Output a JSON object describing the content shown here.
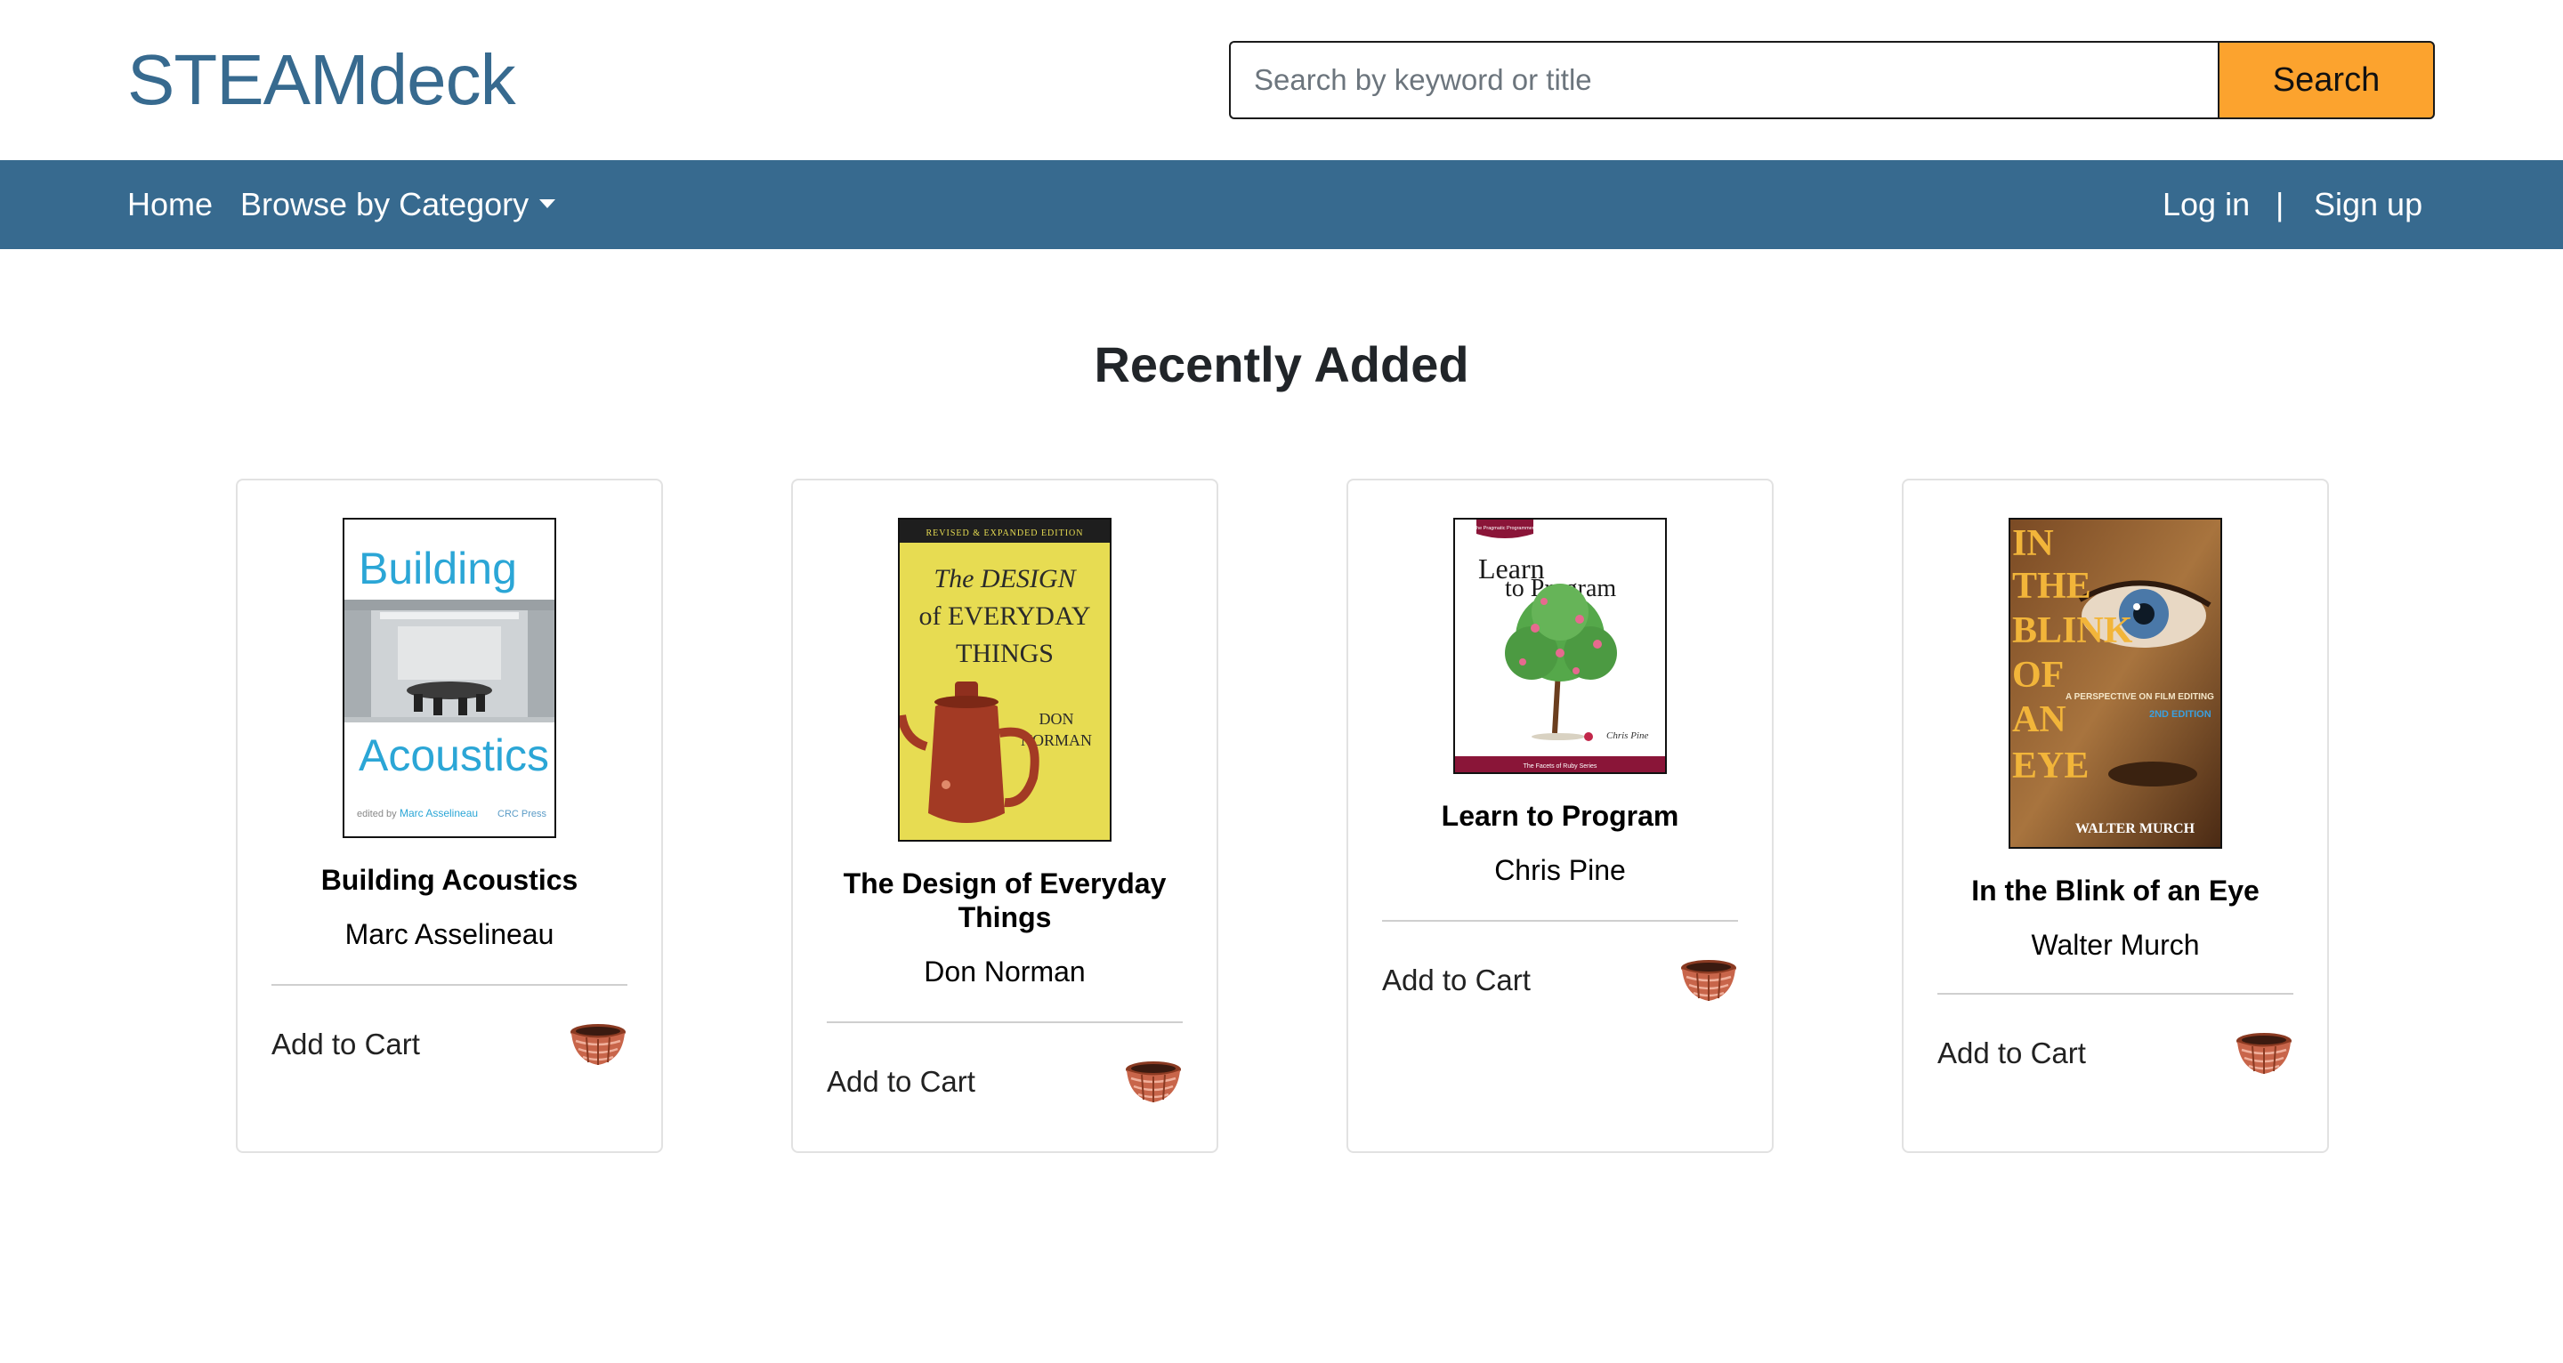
{
  "header": {
    "brand": "STEAMdeck",
    "search_placeholder": "Search by keyword or title",
    "search_button": "Search"
  },
  "nav": {
    "home": "Home",
    "browse": "Browse by Category",
    "login": "Log in",
    "separator": "|",
    "signup": "Sign up"
  },
  "main": {
    "section_title": "Recently Added",
    "add_to_cart_label": "Add to Cart",
    "books": [
      {
        "title": "Building Acoustics",
        "author": "Marc Asselineau",
        "cover": {
          "top_word": "Building",
          "bottom_word": "Acoustics",
          "credit_prefix": "edited by",
          "credit_name": "Marc Asselineau",
          "publisher": "CRC Press"
        }
      },
      {
        "title": "The Design of Everyday Things",
        "author": "Don Norman",
        "cover": {
          "edition": "REVISED & EXPANDED EDITION",
          "line1": "The DESIGN",
          "line2": "of EVERYDAY",
          "line3": "THINGS",
          "author1": "DON",
          "author2": "NORMAN"
        }
      },
      {
        "title": "Learn to Program",
        "author": "Chris Pine",
        "cover": {
          "series": "The Pragmatic Programmers",
          "line1": "Learn",
          "line2": "to Program",
          "author": "Chris Pine",
          "footer": "The Facets of Ruby Series"
        }
      },
      {
        "title": "In the Blink of an Eye",
        "author": "Walter Murch",
        "cover": {
          "words": [
            "IN",
            "THE",
            "BLINK",
            "OF",
            "AN",
            "EYE"
          ],
          "subtitle": "A PERSPECTIVE ON FILM EDITING",
          "edition": "2ND EDITION",
          "author": "WALTER MURCH"
        }
      }
    ]
  },
  "colors": {
    "brand": "#376a8f",
    "nav_background": "#376a8f",
    "search_button": "#fca32e"
  },
  "icons": {
    "cart": "basket-icon",
    "dropdown": "caret-down-icon"
  }
}
